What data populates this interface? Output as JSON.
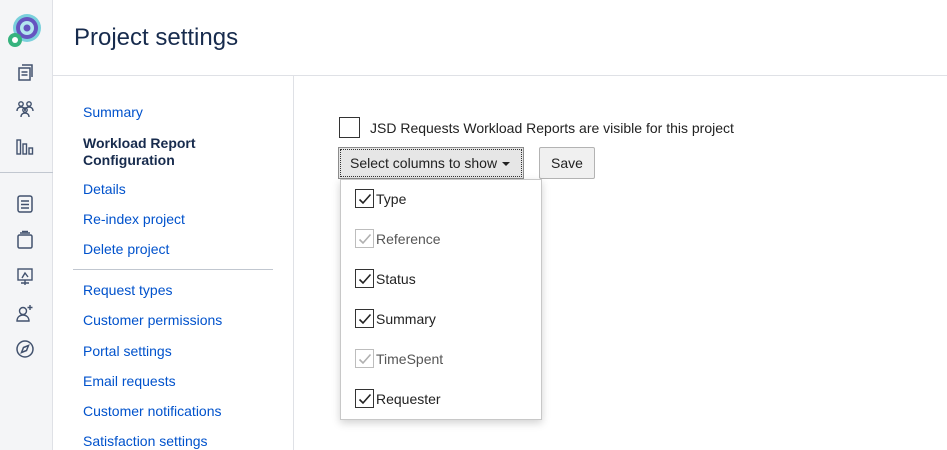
{
  "page": {
    "title": "Project settings"
  },
  "rail": {
    "icons": [
      "queues-icon",
      "customers-icon",
      "reports-icon",
      "knowledge-base-icon",
      "raise-request-icon",
      "channels-icon",
      "invite-team-icon",
      "compass-icon"
    ]
  },
  "nav": {
    "summary": "Summary",
    "active": "Workload Report Configuration",
    "details": "Details",
    "reindex": "Re-index project",
    "delete": "Delete project",
    "request_types": "Request types",
    "customer_permissions": "Customer permissions",
    "portal_settings": "Portal settings",
    "email_requests": "Email requests",
    "customer_notifications": "Customer notifications",
    "satisfaction_settings": "Satisfaction settings"
  },
  "main": {
    "visibility_label": "JSD Requests Workload Reports are visible for this project",
    "visibility_checked": false,
    "select_label": "Select columns to show",
    "save_label": "Save"
  },
  "columns": [
    {
      "label": "Type",
      "checked": true,
      "disabled": false
    },
    {
      "label": "Reference",
      "checked": true,
      "disabled": true
    },
    {
      "label": "Status",
      "checked": true,
      "disabled": false
    },
    {
      "label": "Summary",
      "checked": true,
      "disabled": false
    },
    {
      "label": "TimeSpent",
      "checked": true,
      "disabled": true
    },
    {
      "label": "Requester",
      "checked": true,
      "disabled": false
    }
  ],
  "colors": {
    "link": "#0052cc",
    "text": "#172b4d",
    "logo_teal": "#36b37e",
    "logo_purple": "#6554c0"
  }
}
